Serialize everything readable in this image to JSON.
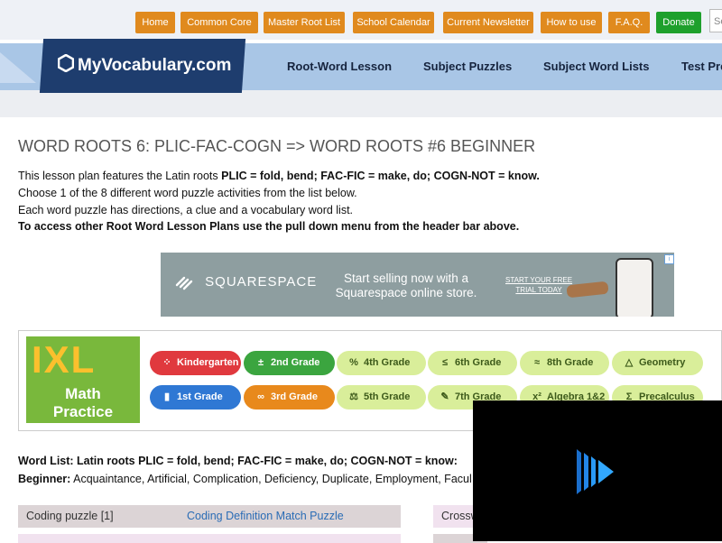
{
  "topnav": {
    "buttons": [
      "Home",
      "Common Core",
      "Master Root List",
      "School Calendar",
      "Current Newsletter",
      "How to use",
      "F.A.Q.",
      "Donate"
    ],
    "search_placeholder": "Se"
  },
  "header": {
    "logo_text": "MyVocabulary.com",
    "nav": [
      "Root-Word Lesson",
      "Subject Puzzles",
      "Subject Word Lists",
      "Test Pre"
    ]
  },
  "main": {
    "title": "WORD ROOTS 6: PLIC-FAC-COGN => WORD ROOTS #6 BEGINNER",
    "intro_prefix": "This lesson plan features the Latin roots ",
    "intro_bold": "PLIC = fold, bend; FAC-FIC = make, do; COGN-NOT = know.",
    "line2": "Choose 1 of the 8 different word puzzle activities from the list below.",
    "line3": "Each word puzzle has directions, a clue and a vocabulary word list.",
    "line4": "To access other Root Word Lesson Plans use the pull down menu from the header bar above."
  },
  "ad_squarespace": {
    "brand": "SQUARESPACE",
    "text": "Start selling now with a Squarespace online store.",
    "cta_line1": "START YOUR FREE",
    "cta_line2": "TRIAL TODAY",
    "info_icon": "i"
  },
  "ad_ixl": {
    "logo": "IXL",
    "math_line1": "Math",
    "math_line2": "Practice",
    "pills": [
      {
        "label": "Kindergarten",
        "icon": "dots-icon",
        "glyph": "⁘",
        "bg": "#e0393e",
        "fg": "#ffffff"
      },
      {
        "label": "2nd Grade",
        "icon": "plus-minus-icon",
        "glyph": "±",
        "bg": "#3ba53f",
        "fg": "#ffffff"
      },
      {
        "label": "4th Grade",
        "icon": "percent-icon",
        "glyph": "%",
        "bg": "#d9ee9a",
        "fg": "#3d5a1a"
      },
      {
        "label": "6th Grade",
        "icon": "less-equal-icon",
        "glyph": "≤",
        "bg": "#d9ee9a",
        "fg": "#3d5a1a"
      },
      {
        "label": "8th Grade",
        "icon": "approx-icon",
        "glyph": "≈",
        "bg": "#d9ee9a",
        "fg": "#3d5a1a"
      },
      {
        "label": "Geometry",
        "icon": "triangle-icon",
        "glyph": "△",
        "bg": "#d9ee9a",
        "fg": "#3d5a1a"
      },
      {
        "label": "1st Grade",
        "icon": "cup-icon",
        "glyph": "▮",
        "bg": "#2f78d4",
        "fg": "#ffffff"
      },
      {
        "label": "3rd Grade",
        "icon": "infinity-icon",
        "glyph": "∞",
        "bg": "#e8891c",
        "fg": "#ffffff"
      },
      {
        "label": "5th Grade",
        "icon": "scale-icon",
        "glyph": "⚖",
        "bg": "#d9ee9a",
        "fg": "#3d5a1a"
      },
      {
        "label": "7th Grade",
        "icon": "pencil-icon",
        "glyph": "✎",
        "bg": "#d9ee9a",
        "fg": "#3d5a1a"
      },
      {
        "label": "Algebra 1&2",
        "icon": "x-squared-icon",
        "glyph": "x²",
        "bg": "#d9ee9a",
        "fg": "#3d5a1a"
      },
      {
        "label": "Precalculus",
        "icon": "sigma-icon",
        "glyph": "Σ",
        "bg": "#d9ee9a",
        "fg": "#3d5a1a"
      }
    ]
  },
  "wordlist": {
    "heading": "Word List: Latin roots PLIC = fold, bend; FAC-FIC = make, do; COGN-NOT = know:",
    "beginner_label": "Beginner:",
    "beginner_words": " Acquaintance, Artificial, Complication, Deficiency, Duplicate, Employment, Facul"
  },
  "puzzles": {
    "row1_type": "Coding puzzle [1]",
    "row1_link": "Coding Definition Match Puzzle",
    "right_type": "Crossw"
  },
  "colors": {
    "nav_orange": "#e08a1e",
    "donate_green": "#1ea02c",
    "logo_navy": "#1e3d6e",
    "header_blue": "#a9c6e6",
    "link_blue": "#2a6cb5"
  }
}
